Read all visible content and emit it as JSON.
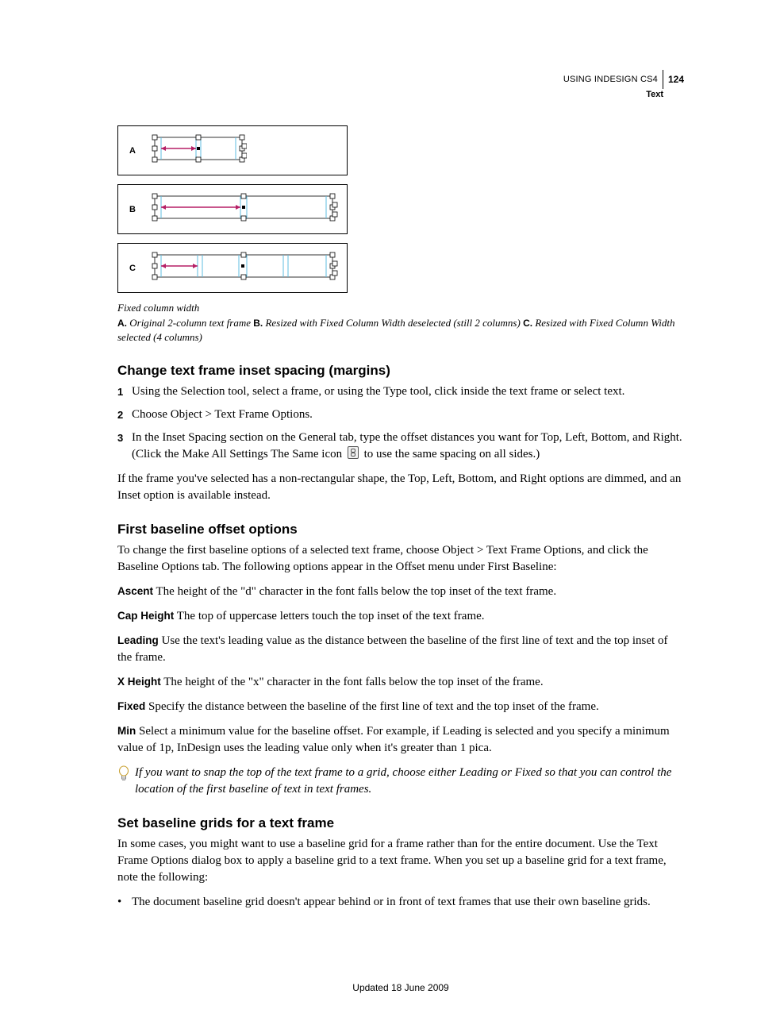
{
  "header": {
    "title": "USING INDESIGN CS4",
    "page_number": "124",
    "section": "Text"
  },
  "figure": {
    "caption": "Fixed column width",
    "legend_a_label": "A.",
    "legend_a_text": " Original 2-column text frame  ",
    "legend_b_label": "B.",
    "legend_b_text": " Resized with Fixed Column Width deselected (still 2 columns)  ",
    "legend_c_label": "C.",
    "legend_c_text": " Resized with Fixed Column Width selected (4 columns)",
    "panel_labels": {
      "a": "A",
      "b": "B",
      "c": "C"
    }
  },
  "sec1": {
    "heading": "Change text frame inset spacing (margins)",
    "step1_num": "1",
    "step1_text": "Using the Selection tool, select a frame, or using the Type tool, click inside the text frame or select text.",
    "step2_num": "2",
    "step2_text": "Choose Object > Text Frame Options.",
    "step3_num": "3",
    "step3_text_a": "In the Inset Spacing section on the General tab, type the offset distances you want for Top, Left, Bottom, and Right. (Click the Make All Settings The Same icon ",
    "step3_text_b": " to use the same spacing on all sides.)",
    "para": "If the frame you've selected has a non-rectangular shape, the Top, Left, Bottom, and Right options are dimmed, and an Inset option is available instead."
  },
  "sec2": {
    "heading": "First baseline offset options",
    "intro": "To change the first baseline options of a selected text frame, choose Object > Text Frame Options, and click the Baseline Options tab. The following options appear in the Offset menu under First Baseline:",
    "ascent_term": "Ascent",
    "ascent_text": "  The height of the \"d\" character in the font falls below the top inset of the text frame.",
    "cap_term": "Cap Height",
    "cap_text": "  The top of uppercase letters touch the top inset of the text frame.",
    "lead_term": "Leading",
    "lead_text": "  Use the text's leading value as the distance between the baseline of the first line of text and the top inset of the frame.",
    "xh_term": "X Height",
    "xh_text": "  The height of the \"x\" character in the font falls below the top inset of the frame.",
    "fixed_term": "Fixed",
    "fixed_text": "  Specify the distance between the baseline of the first line of text and the top inset of the frame.",
    "min_term": "Min",
    "min_text": "  Select a minimum value for the baseline offset. For example, if Leading is selected and you specify a minimum value of 1p, InDesign uses the leading value only when it's greater than 1 pica.",
    "tip": "If you want to snap the top of the text frame to a grid, choose either Leading or Fixed so that you can control the location of the first baseline of text in text frames."
  },
  "sec3": {
    "heading": "Set baseline grids for a text frame",
    "intro": "In some cases, you might want to use a baseline grid for a frame rather than for the entire document. Use the Text Frame Options dialog box to apply a baseline grid to a text frame. When you set up a baseline grid for a text frame, note the following:",
    "bullet1": "The document baseline grid doesn't appear behind or in front of text frames that use their own baseline grids."
  },
  "footer": {
    "updated": "Updated 18 June 2009"
  }
}
